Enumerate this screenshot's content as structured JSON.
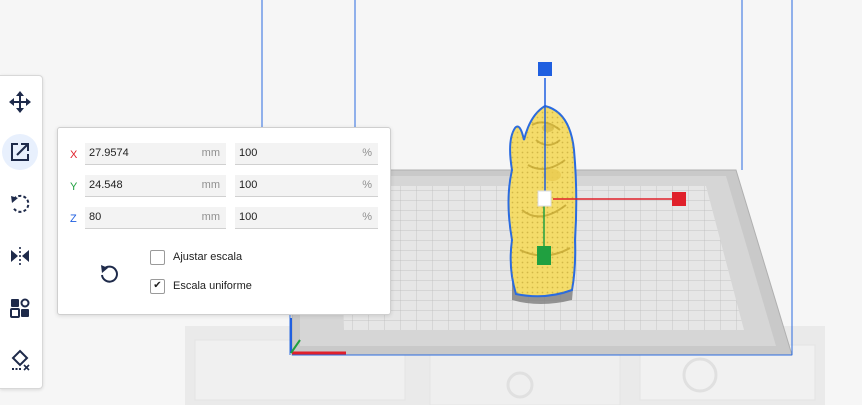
{
  "colors": {
    "accent": "#2568d8",
    "axis_x": "#e0202a",
    "axis_y": "#20a040",
    "axis_z": "#1f5fe0",
    "model": "#f4dc6a",
    "model_outline": "#2a6be0",
    "icon": "#1e2a4a"
  },
  "toolbar": {
    "items": [
      {
        "name": "move",
        "icon": "move-icon"
      },
      {
        "name": "scale",
        "icon": "scale-icon",
        "active": true
      },
      {
        "name": "rotate",
        "icon": "rotate-icon"
      },
      {
        "name": "mirror",
        "icon": "mirror-icon"
      },
      {
        "name": "per-model-settings",
        "icon": "per-model-settings-icon"
      },
      {
        "name": "support-blocker",
        "icon": "support-blocker-icon"
      }
    ]
  },
  "scale_panel": {
    "rows": [
      {
        "axis": "X",
        "size": "27.9574",
        "size_unit": "mm",
        "percent": "100",
        "percent_unit": "%"
      },
      {
        "axis": "Y",
        "size": "24.548",
        "size_unit": "mm",
        "percent": "100",
        "percent_unit": "%"
      },
      {
        "axis": "Z",
        "size": "80",
        "size_unit": "mm",
        "percent": "100",
        "percent_unit": "%"
      }
    ],
    "snap_scaling": {
      "label": "Ajustar escala",
      "checked": false
    },
    "uniform_scaling": {
      "label": "Escala uniforme",
      "checked": true
    }
  }
}
